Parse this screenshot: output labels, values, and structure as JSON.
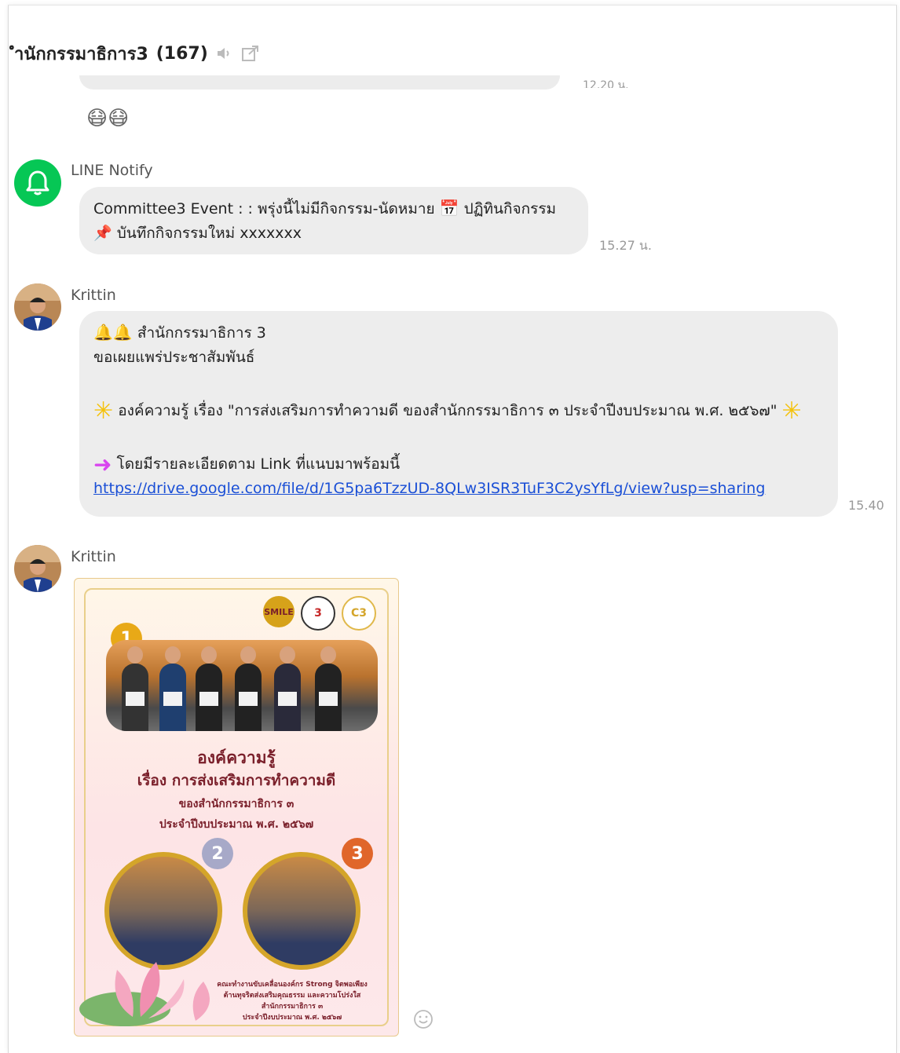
{
  "chat": {
    "title": "ำนักกรรมาธิการ3",
    "member_count": "(167)"
  },
  "previous": {
    "time": "12.20 น.",
    "sticker": "😷😷"
  },
  "messages": [
    {
      "sender": "LINE Notify",
      "lines": [
        "Committee3 Event  : : พรุ่งนี้ไม่มีกิจกรรม-นัดหมาย",
        "ปฏิทินกิจกรรม",
        "บันทึกกิจกรรมใหม่  xxxxxxx"
      ],
      "time": "15.27 น."
    },
    {
      "sender": "Krittin",
      "lines": [
        "สำนักกรรมาธิการ 3",
        "ขอเผยแพร่ประชาสัมพันธ์",
        "องค์ความรู้ เรื่อง \"การส่งเสริมการทำความดี ของสำนักกรรมาธิการ ๓ ประจำปีงบประมาณ พ.ศ. ๒๕๖๗\"",
        "โดยมีรายละเอียดตาม Link ที่แนบมาพร้อมนี้"
      ],
      "link": "https://drive.google.com/file/d/1G5pa6TzzUD-8QLw3ISR3TuF3C2ysYfLg/view?usp=sharing",
      "time": "15.40"
    },
    {
      "sender": "Krittin",
      "poster": {
        "title_1": "องค์ความรู้",
        "title_2": "เรื่อง การส่งเสริมการทำความดี",
        "title_3": "ของสำนักกรรมาธิการ ๓",
        "title_4": "ประจำปีงบประมาณ พ.ศ. ๒๕๖๗",
        "medal_1": "1",
        "medal_2": "2",
        "medal_3": "3",
        "logo_1": "SMILE",
        "logo_2": "3",
        "logo_3": "C3",
        "footer_1": "คณะทำงานขับเคลื่อนองค์กร Strong จิตพอเพียง",
        "footer_2": "ต้านทุจริตส่งเสริมคุณธรรม และความโปร่งใส",
        "footer_3": "สำนักกรรมาธิการ ๓",
        "footer_4": "ประจำปีงบประมาณ พ.ศ. ๒๕๖๗"
      }
    }
  ],
  "colors": {
    "notify_green": "#06c755",
    "bubble": "#ededed",
    "link": "#1a4fd6"
  }
}
